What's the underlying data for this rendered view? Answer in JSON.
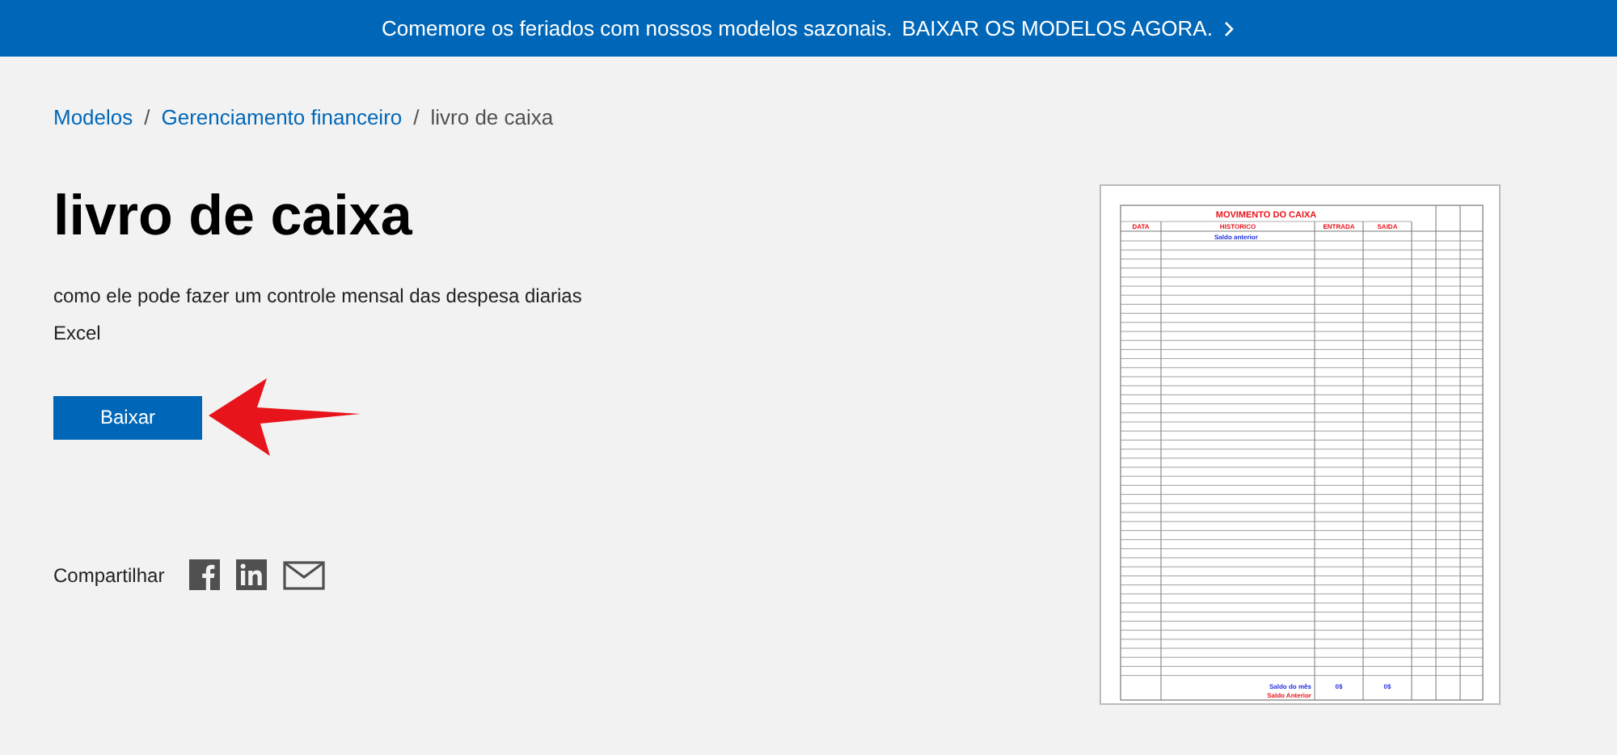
{
  "banner": {
    "text": "Comemore os feriados com nossos modelos sazonais.",
    "link": "BAIXAR OS MODELOS AGORA."
  },
  "breadcrumb": {
    "separator": "/",
    "items": [
      {
        "label": "Modelos",
        "current": false
      },
      {
        "label": "Gerenciamento financeiro",
        "current": false
      },
      {
        "label": "livro de caixa",
        "current": true
      }
    ]
  },
  "title": "livro de caixa",
  "description": "como ele pode fazer um controle mensal das despesa diarias",
  "file_type": "Excel",
  "download_button": "Baixar",
  "share": {
    "label": "Compartilhar",
    "buttons": [
      {
        "kind": "facebook"
      },
      {
        "kind": "linkedin"
      },
      {
        "kind": "email"
      }
    ]
  },
  "preview": {
    "title": "MOVIMENTO DO CAIXA",
    "columns": [
      "DATA",
      "HISTORICO",
      "ENTRADA",
      "SAIDA"
    ],
    "first_entry": "Saldo anterior",
    "totals": {
      "label": "Saldo do mês",
      "entrada": "0$",
      "saida": "0$"
    },
    "closing_label": "Saldo Anterior"
  }
}
